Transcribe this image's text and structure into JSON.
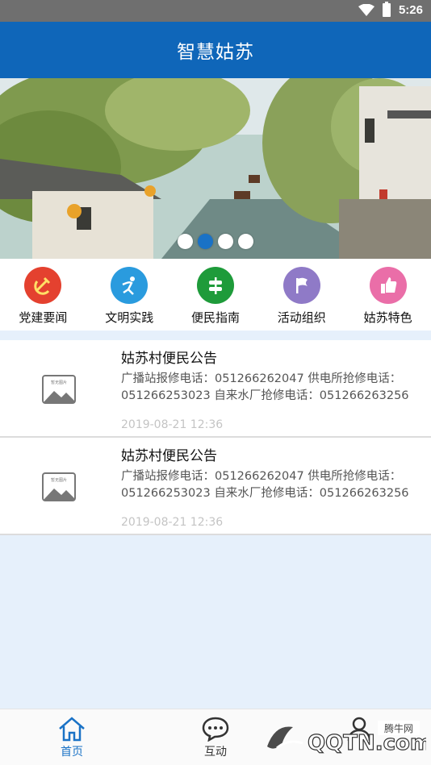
{
  "status": {
    "time": "5:26"
  },
  "header": {
    "title": "智慧姑苏"
  },
  "banner": {
    "slide_count": 4,
    "active_index": 1
  },
  "quick_nav": [
    {
      "label": "党建要闻",
      "icon": "hammer-sickle-icon",
      "color": "#e4412f"
    },
    {
      "label": "文明实践",
      "icon": "runner-icon",
      "color": "#2a9bde"
    },
    {
      "label": "便民指南",
      "icon": "signpost-icon",
      "color": "#1e9b3a"
    },
    {
      "label": "活动组织",
      "icon": "flag-icon",
      "color": "#8f7ac7"
    },
    {
      "label": "姑苏特色",
      "icon": "thumbs-up-icon",
      "color": "#ea6ea8"
    }
  ],
  "news": [
    {
      "title": "姑苏村便民公告",
      "body": "广播站报修电话：051266262047 供电所抢修电话：051266253023 自来水厂抢修电话：051266263256 ...",
      "date": "2019-08-21 12:36",
      "thumb_text": "暂无图片"
    },
    {
      "title": "姑苏村便民公告",
      "body": "广播站报修电话：051266262047 供电所抢修电话：051266253023 自来水厂抢修电话：051266263256 ...",
      "date": "2019-08-21 12:36",
      "thumb_text": "暂无图片"
    }
  ],
  "tabbar": [
    {
      "label": "首页",
      "icon": "home-icon",
      "active": true
    },
    {
      "label": "互动",
      "icon": "chat-bubble-icon",
      "active": false
    },
    {
      "label": "",
      "icon": "user-icon",
      "active": false
    }
  ],
  "watermark": {
    "brand": "QQTN.com",
    "site": "腾牛网"
  }
}
